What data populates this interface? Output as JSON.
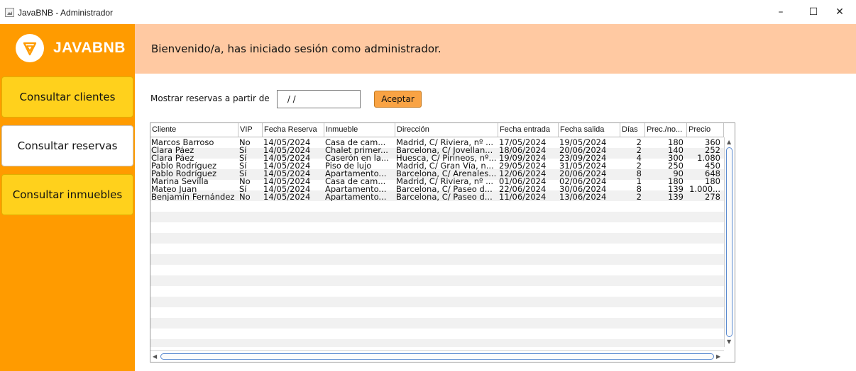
{
  "window": {
    "title": "JavaBNB - Administrador",
    "controls": {
      "minimize": "–",
      "maximize": "☐",
      "close": "✕"
    }
  },
  "sidebar": {
    "logo_text": "JAVABNB",
    "items": [
      {
        "label": "Consultar clientes",
        "active": false
      },
      {
        "label": "Consultar reservas",
        "active": true
      },
      {
        "label": "Consultar inmuebles",
        "active": false
      }
    ]
  },
  "header": {
    "welcome": "Bienvenido/a, has iniciado sesión como administrador."
  },
  "filter": {
    "label": "Mostrar reservas a partir de",
    "date_value": " / /",
    "accept_label": "Aceptar"
  },
  "table": {
    "columns": [
      "Cliente",
      "VIP",
      "Fecha Reserva",
      "Inmueble",
      "Dirección",
      "Fecha entrada",
      "Fecha salida",
      "Días",
      "Prec./no...",
      "Precio"
    ],
    "rows": [
      [
        "Marcos Barroso",
        "No",
        "14/05/2024",
        "Casa de cam...",
        "Madrid, C/ Riviera, nº ...",
        "17/05/2024",
        "19/05/2024",
        "2",
        "180",
        "360"
      ],
      [
        "Clara Páez",
        "Sí",
        "14/05/2024",
        "Chalet primer...",
        "Barcelona, C/ Jovellan...",
        "18/06/2024",
        "20/06/2024",
        "2",
        "140",
        "252"
      ],
      [
        "Clara Páez",
        "Sí",
        "14/05/2024",
        "Caserón en la...",
        "Huesca, C/ Pirineos, nº...",
        "19/09/2024",
        "23/09/2024",
        "4",
        "300",
        "1.080"
      ],
      [
        "Pablo Rodríguez",
        "Sí",
        "14/05/2024",
        "Piso de lujo",
        "Madrid, C/ Gran Vía, n...",
        "29/05/2024",
        "31/05/2024",
        "2",
        "250",
        "450"
      ],
      [
        "Pablo Rodríguez",
        "Sí",
        "14/05/2024",
        "Apartamento...",
        "Barcelona, C/ Arenales...",
        "12/06/2024",
        "20/06/2024",
        "8",
        "90",
        "648"
      ],
      [
        "Marina Sevilla",
        "No",
        "14/05/2024",
        "Casa de cam...",
        "Madrid, C/ Riviera, nº ...",
        "01/06/2024",
        "02/06/2024",
        "1",
        "180",
        "180"
      ],
      [
        "Mateo Juan",
        "Sí",
        "14/05/2024",
        "Apartamento...",
        "Barcelona, C/ Paseo d...",
        "22/06/2024",
        "30/06/2024",
        "8",
        "139",
        "1.000..."
      ],
      [
        "Benjamín Fernández",
        "No",
        "14/05/2024",
        "Apartamento...",
        "Barcelona, C/ Paseo d...",
        "11/06/2024",
        "13/06/2024",
        "2",
        "139",
        "278"
      ]
    ]
  },
  "colors": {
    "sidebar": "#ff9b00",
    "nav_button": "#ffd11c",
    "header": "#ffc9a2",
    "accept_button": "#f9a344"
  }
}
